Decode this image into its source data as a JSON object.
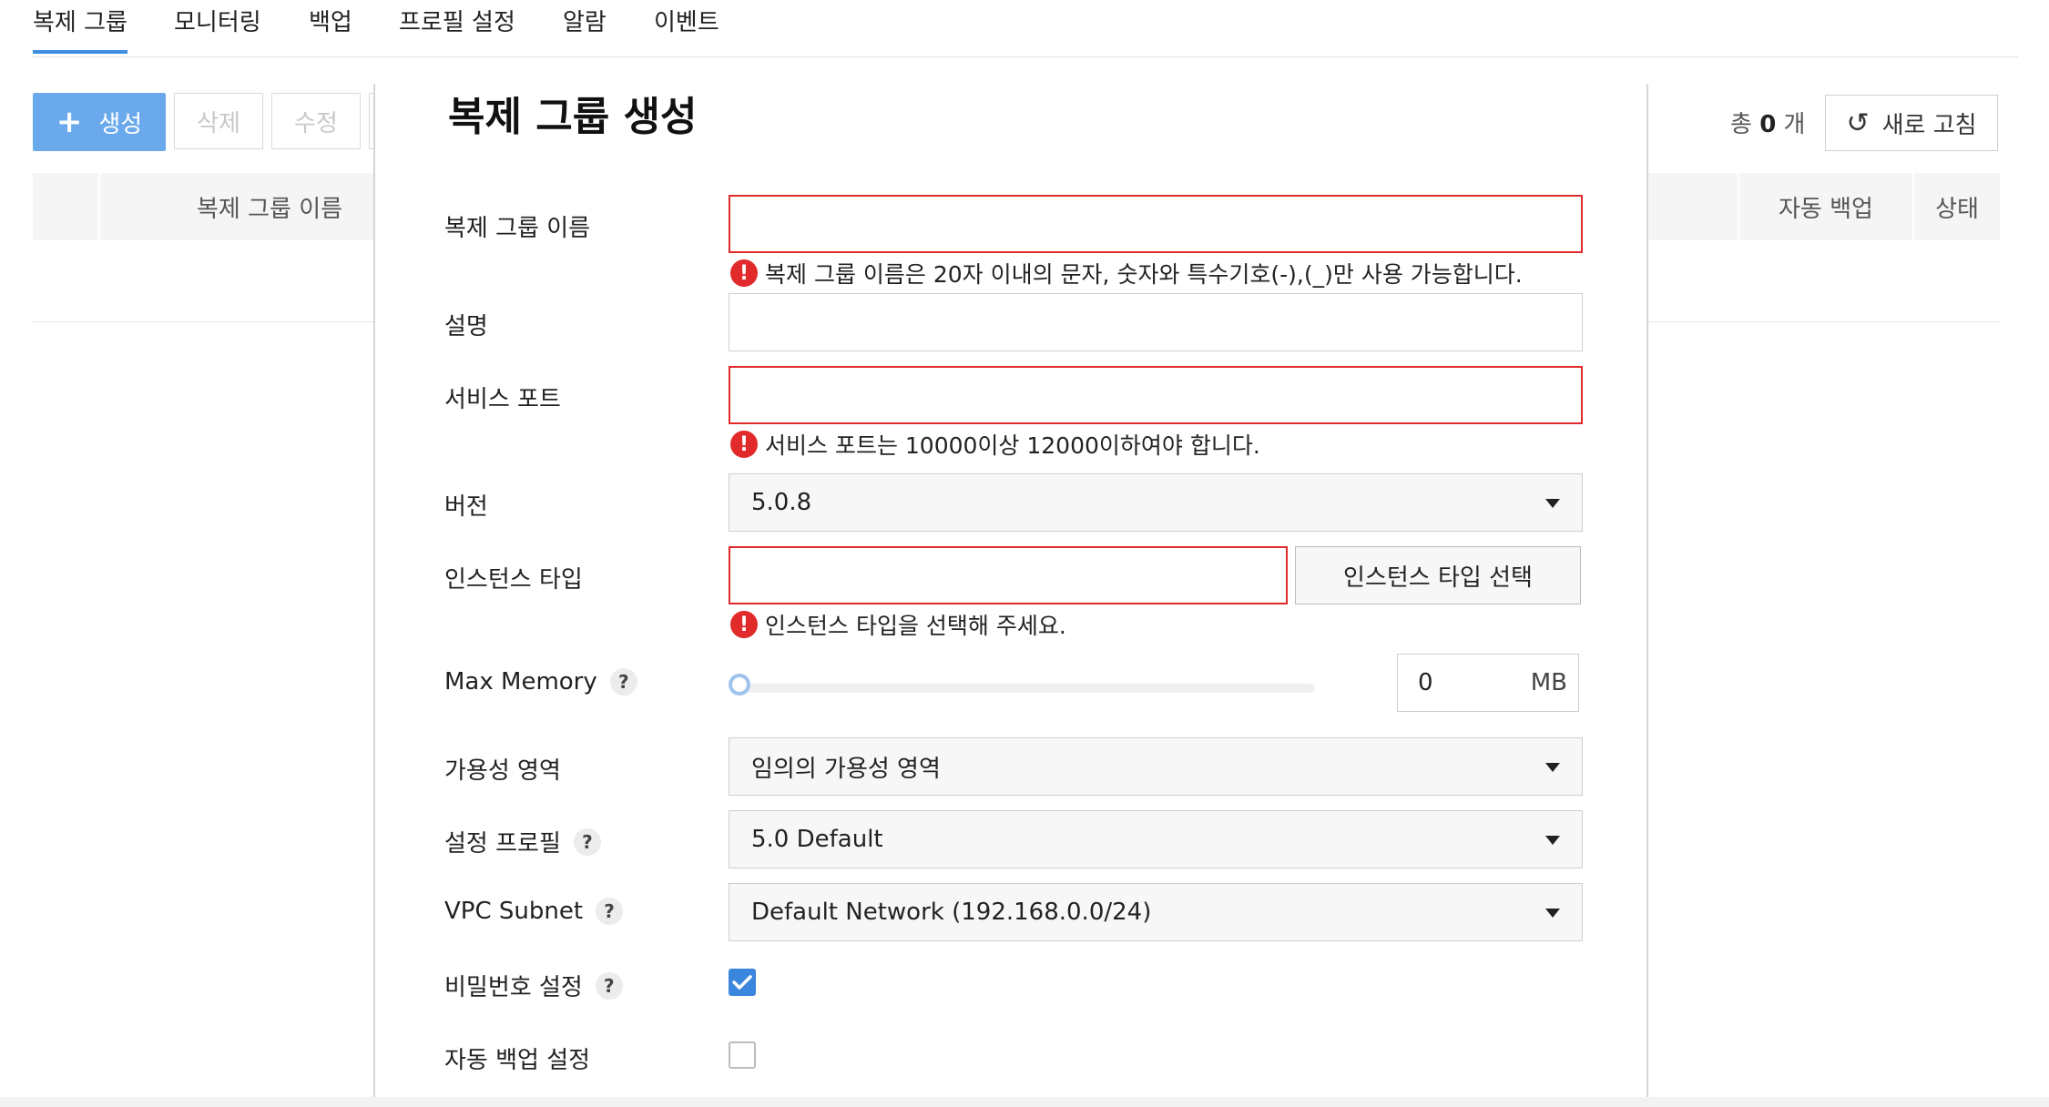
{
  "tabs": [
    "복제 그룹",
    "모니터링",
    "백업",
    "프로필 설정",
    "알람",
    "이벤트"
  ],
  "toolbar": {
    "create": "생성",
    "delete": "삭제",
    "edit": "수정",
    "total_prefix": "총",
    "total_count": "0",
    "total_suffix": "개",
    "refresh": "새로 고침"
  },
  "table": {
    "col_name": "복제 그룹 이름",
    "col_auto_backup": "자동 백업",
    "col_status": "상태"
  },
  "modal": {
    "title": "복제 그룹 생성",
    "name_label": "복제 그룹 이름",
    "name_value": "",
    "name_error": "복제 그룹 이름은 20자 이내의 문자, 숫자와 특수기호(-),(_)만 사용 가능합니다.",
    "desc_label": "설명",
    "desc_value": "",
    "port_label": "서비스 포트",
    "port_value": "",
    "port_error": "서비스 포트는 10000이상 12000이하여야 합니다.",
    "version_label": "버전",
    "version_value": "5.0.8",
    "instance_label": "인스턴스 타입",
    "instance_value": "",
    "instance_button": "인스턴스 타입 선택",
    "instance_error": "인스턴스 타입을 선택해 주세요.",
    "memory_label": "Max Memory",
    "memory_value": "0",
    "memory_unit": "MB",
    "memory_slider_fraction": 0,
    "az_label": "가용성 영역",
    "az_value": "임의의 가용성 영역",
    "profile_label": "설정 프로필",
    "profile_value": "5.0 Default",
    "subnet_label": "VPC Subnet",
    "subnet_value": "Default Network (192.168.0.0/24)",
    "password_label": "비밀번호 설정",
    "password_checked": true,
    "autobackup_label": "자동 백업 설정",
    "autobackup_checked": false,
    "help_glyph": "?",
    "error_glyph": "!"
  },
  "colors": {
    "accent": "#3f8ee0",
    "create_button": "#6aa9ec",
    "error": "#e12a2a",
    "checkbox": "#3a86dc"
  }
}
